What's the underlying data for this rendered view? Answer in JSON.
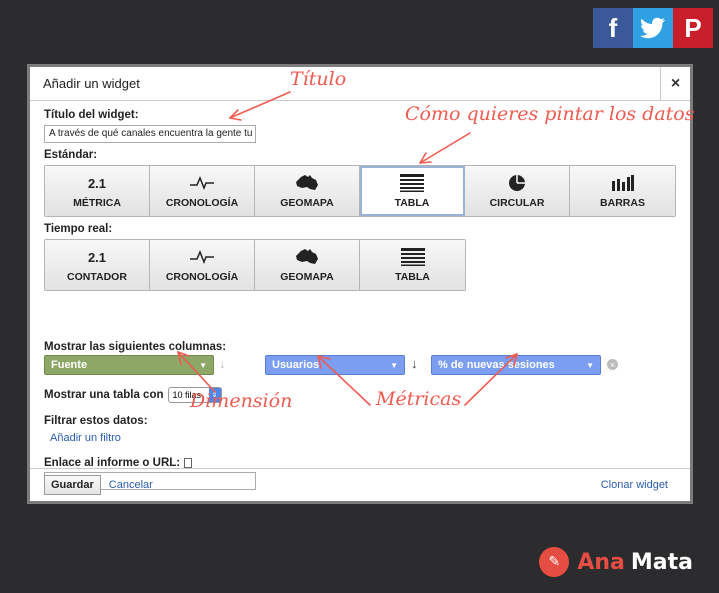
{
  "social": {
    "facebook": "f",
    "twitter": "t",
    "pinterest": "P"
  },
  "dialog": {
    "title": "Añadir un widget",
    "close": "×",
    "widget_title_label": "Título del widget:",
    "widget_title_value": "A través de qué canales encuentra la gente tu l",
    "standard_label": "Estándar:",
    "standard_tiles": [
      {
        "icon": "2.1",
        "label": "MÉTRICA"
      },
      {
        "icon": "∕\\∕",
        "label": "CRONOLOGÍA"
      },
      {
        "icon": "",
        "label": "GEOMAPA"
      },
      {
        "icon": "",
        "label": "TABLA"
      },
      {
        "icon": "",
        "label": "CIRCULAR"
      },
      {
        "icon": "",
        "label": "BARRAS"
      }
    ],
    "realtime_label": "Tiempo real:",
    "realtime_tiles": [
      {
        "icon": "2.1",
        "label": "CONTADOR"
      },
      {
        "icon": "",
        "label": "CRONOLOGÍA"
      },
      {
        "icon": "",
        "label": "GEOMAPA"
      },
      {
        "icon": "",
        "label": "TABLA"
      }
    ],
    "columns_label": "Mostrar las siguientes columnas:",
    "dimension_value": "Fuente",
    "metric1_value": "Usuarios",
    "metric2_value": "% de nuevas sesiones",
    "show_table_label": "Mostrar una tabla con",
    "rows_value": "10 filas",
    "filter_label": "Filtrar estos datos:",
    "add_filter_link": "Añadir un filtro",
    "link_label": "Enlace al informe o URL:",
    "link_value": "",
    "save_button": "Guardar",
    "cancel_link": "Cancelar",
    "clone_link": "Clonar widget"
  },
  "annotations": {
    "title": "Título",
    "how_to_paint": "Cómo quieres pintar los datos",
    "dimension": "Dimensión",
    "metrics": "Métricas"
  },
  "brand": {
    "first": "Ana",
    "second": "Mata"
  },
  "colors": {
    "annotation": "#ef5b50",
    "dimension": "#8da766",
    "metric": "#7b9ef2",
    "link": "#2a5db0"
  }
}
